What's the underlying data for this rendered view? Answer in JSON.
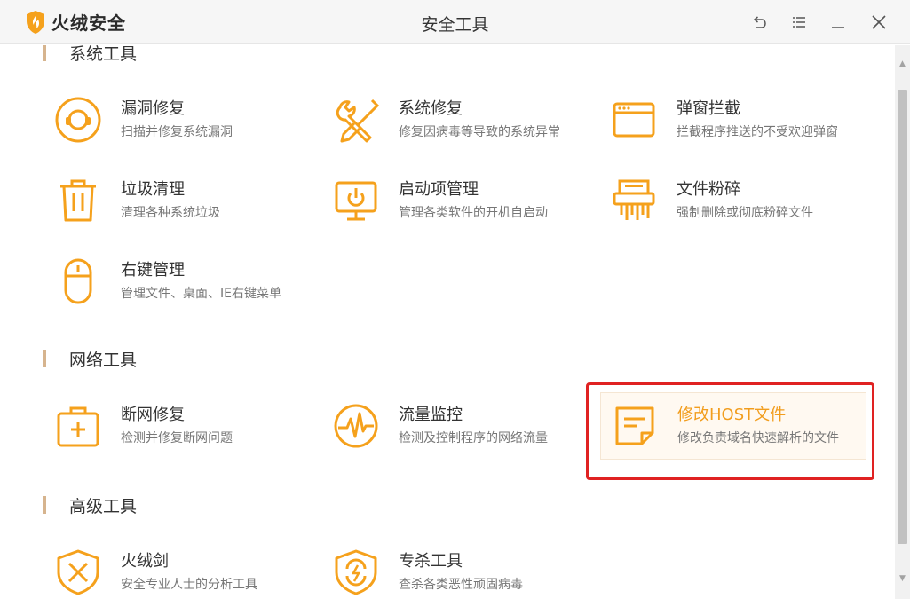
{
  "app": {
    "name": "火绒安全",
    "window_title": "安全工具"
  },
  "colors": {
    "accent": "#f5a11c",
    "highlight": "#e02222",
    "section_bar": "#d6b48e"
  },
  "titlebar": {
    "icons": [
      "back-icon",
      "menu-icon",
      "minimize-icon",
      "close-icon"
    ]
  },
  "sections": [
    {
      "title": "系统工具",
      "partially_visible": true
    },
    {
      "title": "网络工具"
    },
    {
      "title": "高级工具"
    }
  ],
  "system_tools": [
    {
      "name": "漏洞修复",
      "desc": "扫描并修复系统漏洞",
      "icon": "vulnerability-repair-icon"
    },
    {
      "name": "系统修复",
      "desc": "修复因病毒等导致的系统异常",
      "icon": "wrench-screwdriver-icon"
    },
    {
      "name": "弹窗拦截",
      "desc": "拦截程序推送的不受欢迎弹窗",
      "icon": "popup-window-icon"
    },
    {
      "name": "垃圾清理",
      "desc": "清理各种系统垃圾",
      "icon": "trash-icon"
    },
    {
      "name": "启动项管理",
      "desc": "管理各类软件的开机自启动",
      "icon": "monitor-power-icon"
    },
    {
      "name": "文件粉碎",
      "desc": "强制删除或彻底粉碎文件",
      "icon": "shredder-icon"
    },
    {
      "name": "右键管理",
      "desc": "管理文件、桌面、IE右键菜单",
      "icon": "mouse-icon"
    }
  ],
  "network_tools": [
    {
      "name": "断网修复",
      "desc": "检测并修复断网问题",
      "icon": "first-aid-kit-icon"
    },
    {
      "name": "流量监控",
      "desc": "检测及控制程序的网络流量",
      "icon": "traffic-pulse-icon"
    },
    {
      "name": "修改HOST文件",
      "desc": "修改负责域名快速解析的文件",
      "icon": "host-file-icon"
    }
  ],
  "advanced_tools": [
    {
      "name": "火绒剑",
      "desc": "安全专业人士的分析工具",
      "icon": "crossed-swords-shield-icon"
    },
    {
      "name": "专杀工具",
      "desc": "查杀各类恶性顽固病毒",
      "icon": "virus-shield-icon"
    }
  ],
  "scrollbar": {
    "up_arrow": "▲",
    "down_arrow": "▼"
  }
}
